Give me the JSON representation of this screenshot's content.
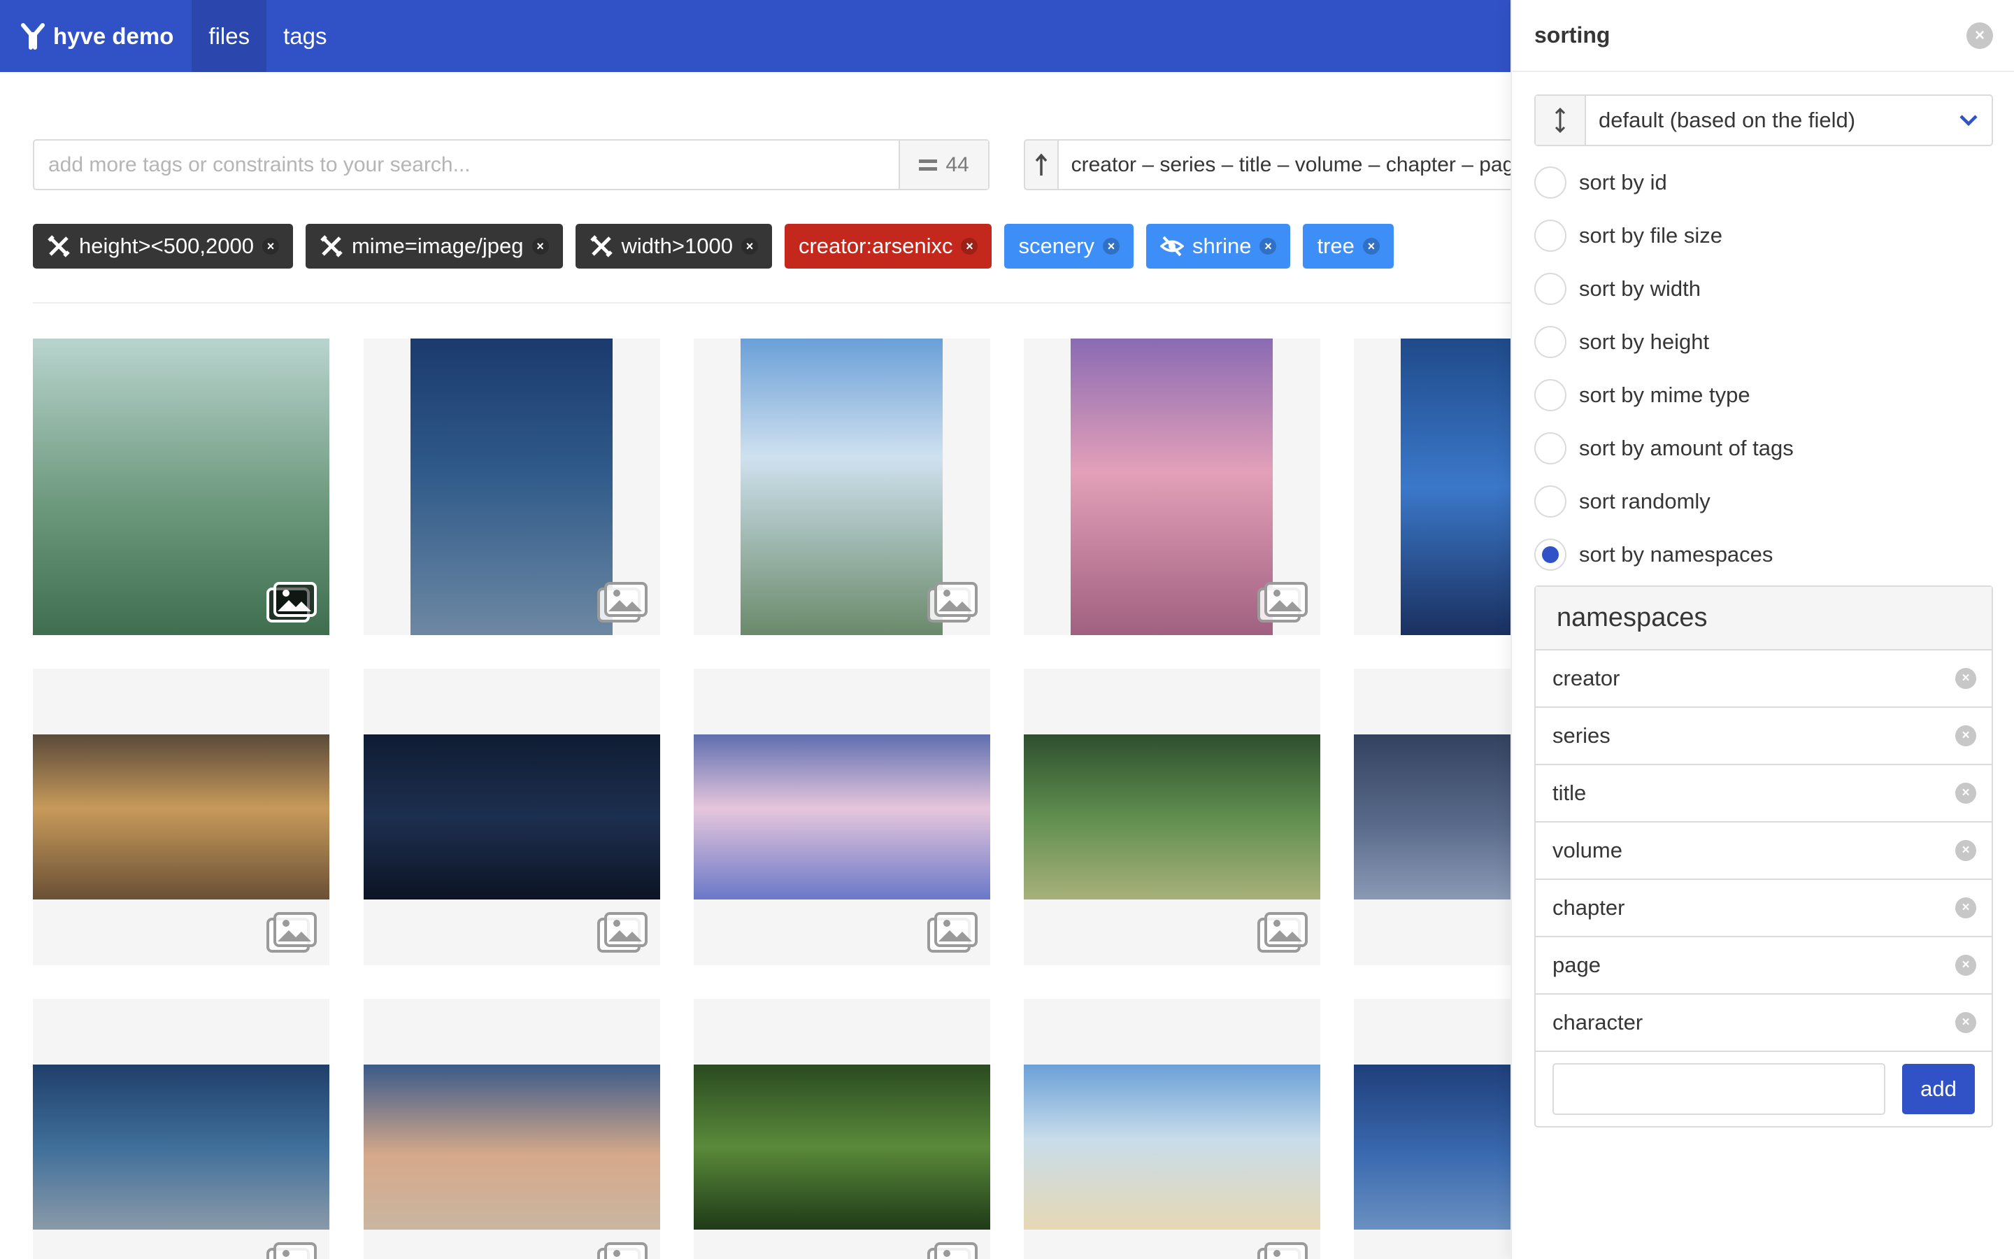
{
  "navbar": {
    "brand": "hyve demo",
    "items": [
      {
        "label": "files",
        "active": true
      },
      {
        "label": "tags",
        "active": false
      }
    ]
  },
  "search": {
    "placeholder": "add more tags or constraints to your search...",
    "count": "44"
  },
  "order": {
    "direction_icon": "arrow-up-icon",
    "text": "creator – series – title – volume – chapter – page"
  },
  "tags": [
    {
      "label": "height><500,2000",
      "style": "dark",
      "icon": "wrench-screwdriver-icon"
    },
    {
      "label": "mime=image/jpeg",
      "style": "dark",
      "icon": "wrench-screwdriver-icon"
    },
    {
      "label": "width>1000",
      "style": "dark",
      "icon": "wrench-screwdriver-icon"
    },
    {
      "label": "creator:arsenixc",
      "style": "red",
      "icon": ""
    },
    {
      "label": "scenery",
      "style": "blue",
      "icon": ""
    },
    {
      "label": "shrine",
      "style": "blue",
      "icon": "eye-slash-icon"
    },
    {
      "label": "tree",
      "style": "blue",
      "icon": ""
    }
  ],
  "sidebar": {
    "title": "sorting",
    "select_value": "default (based on the field)",
    "options": [
      {
        "label": "sort by id",
        "checked": false
      },
      {
        "label": "sort by file size",
        "checked": false
      },
      {
        "label": "sort by width",
        "checked": false
      },
      {
        "label": "sort by height",
        "checked": false
      },
      {
        "label": "sort by mime type",
        "checked": false
      },
      {
        "label": "sort by amount of tags",
        "checked": false
      },
      {
        "label": "sort randomly",
        "checked": false
      },
      {
        "label": "sort by namespaces",
        "checked": true
      }
    ],
    "namespaces": {
      "title": "namespaces",
      "items": [
        "creator",
        "series",
        "title",
        "volume",
        "chapter",
        "page",
        "character"
      ],
      "add_label": "add"
    }
  },
  "colors": {
    "primary": "#3152c7",
    "tag_dark": "#363636",
    "tag_red": "#c4281c",
    "tag_blue": "#3e8ef7"
  }
}
